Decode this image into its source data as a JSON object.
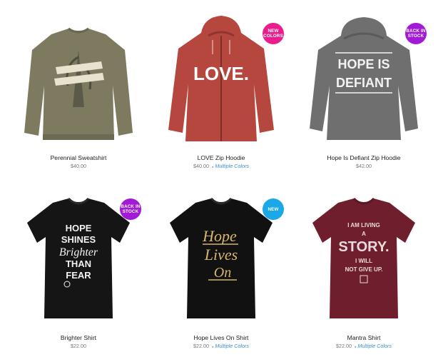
{
  "products": [
    {
      "name": "Perennial Sweatshirt",
      "price": "$40.00",
      "multi": "",
      "badge": "",
      "badge_color": ""
    },
    {
      "name": "LOVE Zip Hoodie",
      "price": "$40.00",
      "multi": "Multiple Colors",
      "badge": "NEW COLORS",
      "badge_color": "#e91e8c",
      "art": "LOVE."
    },
    {
      "name": "Hope Is Defiant Zip Hoodie",
      "price": "$42.00",
      "multi": "",
      "badge": "BACK IN STOCK",
      "badge_color": "#a21ad6",
      "art": [
        "HOPE IS",
        "DEFIANT"
      ]
    },
    {
      "name": "Brighter Shirt",
      "price": "$22.00",
      "multi": "",
      "badge": "BACK IN STOCK",
      "badge_color": "#a21ad6",
      "art": [
        "HOPE",
        "SHINES",
        "Brighter",
        "THAN",
        "FEAR"
      ]
    },
    {
      "name": "Hope Lives On Shirt",
      "price": "$22.00",
      "multi": "Multiple Colors",
      "badge": "NEW",
      "badge_color": "#1ba8e6",
      "art": [
        "Hope",
        "Lives",
        "On"
      ]
    },
    {
      "name": "Mantra Shirt",
      "price": "$22.00",
      "multi": "Multiple Colors",
      "badge": "",
      "badge_color": "",
      "art": [
        "I AM LIVING",
        "A",
        "STORY.",
        "I WILL",
        "NOT GIVE UP."
      ]
    }
  ],
  "colors": {
    "olive": "#7d7a60",
    "rust": "#b5473e",
    "heather": "#6f6f70",
    "black": "#151515",
    "maroon": "#6e1e2c",
    "link": "#3a8fd0"
  }
}
